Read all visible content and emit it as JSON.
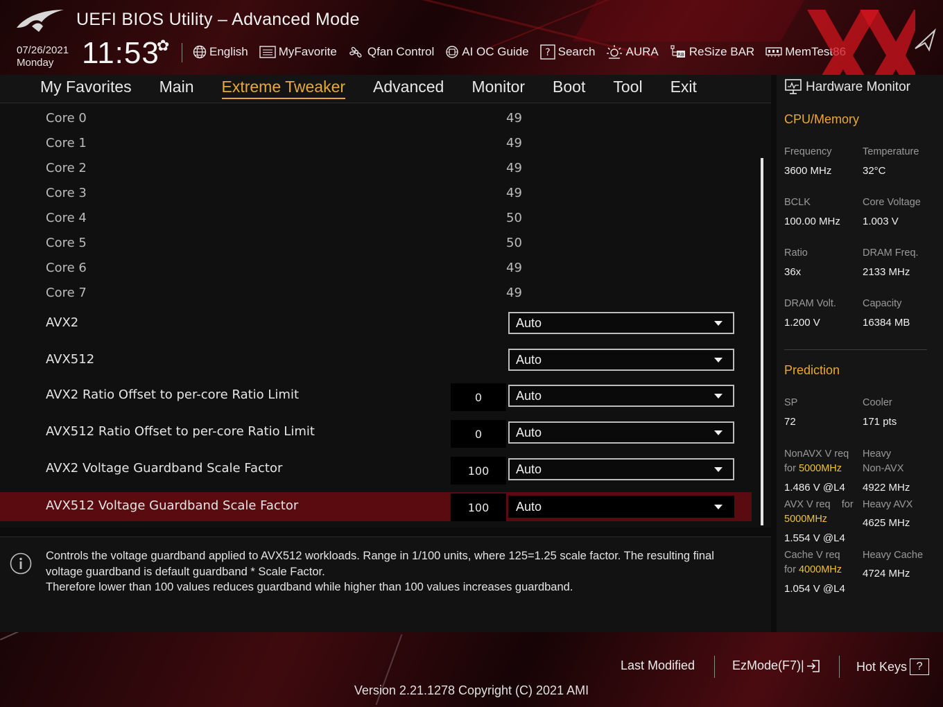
{
  "header": {
    "title": "UEFI BIOS Utility – Advanced Mode",
    "date": "07/26/2021",
    "day": "Monday",
    "time": "11:53",
    "tools": [
      {
        "label": "English",
        "icon": "globe-icon"
      },
      {
        "label": "MyFavorite",
        "icon": "favorite-icon"
      },
      {
        "label": "Qfan Control",
        "icon": "fan-icon"
      },
      {
        "label": "AI OC Guide",
        "icon": "ai-chip-icon"
      },
      {
        "label": "Search",
        "icon": "help-search-icon"
      },
      {
        "label": "AURA",
        "icon": "aura-light-icon"
      },
      {
        "label": "ReSize BAR",
        "icon": "resize-bar-icon"
      },
      {
        "label": "MemTest86",
        "icon": "memory-icon"
      }
    ]
  },
  "nav": {
    "tabs": [
      "My Favorites",
      "Main",
      "Extreme Tweaker",
      "Advanced",
      "Monitor",
      "Boot",
      "Tool",
      "Exit"
    ],
    "active": "Extreme Tweaker"
  },
  "settings": {
    "cores": [
      {
        "label": "Core 0",
        "value": "49"
      },
      {
        "label": "Core 1",
        "value": "49"
      },
      {
        "label": "Core 2",
        "value": "49"
      },
      {
        "label": "Core 3",
        "value": "49"
      },
      {
        "label": "Core 4",
        "value": "50"
      },
      {
        "label": "Core 5",
        "value": "50"
      },
      {
        "label": "Core 6",
        "value": "49"
      },
      {
        "label": "Core 7",
        "value": "49"
      }
    ],
    "options": [
      {
        "label": "AVX2",
        "box": "",
        "selected": "Auto"
      },
      {
        "label": "AVX512",
        "box": "",
        "selected": "Auto"
      },
      {
        "label": "AVX2 Ratio Offset to per-core Ratio Limit",
        "box": "0",
        "selected": "Auto"
      },
      {
        "label": "AVX512 Ratio Offset to per-core Ratio Limit",
        "box": "0",
        "selected": "Auto"
      },
      {
        "label": "AVX2 Voltage Guardband Scale Factor",
        "box": "100",
        "selected": "Auto"
      },
      {
        "label": "AVX512 Voltage Guardband Scale Factor",
        "box": "100",
        "selected": "Auto"
      }
    ]
  },
  "help": {
    "line1": "Controls the voltage guardband applied to AVX512 workloads. Range in 1/100 units, where 125=1.25 scale factor. The resulting final",
    "line2": "voltage guardband is default guardband * Scale Factor.",
    "line3": "Therefore lower than 100 values reduces guardband while higher than 100 values increases guardband."
  },
  "hw": {
    "title": "Hardware Monitor",
    "cpu_section": "CPU/Memory",
    "freq_label": "Frequency",
    "freq_value": "3600 MHz",
    "temp_label": "Temperature",
    "temp_value": "32°C",
    "bclk_label": "BCLK",
    "bclk_value": "100.00 MHz",
    "corev_label": "Core Voltage",
    "corev_value": "1.003 V",
    "ratio_label": "Ratio",
    "ratio_value": "36x",
    "dramf_label": "DRAM Freq.",
    "dramf_value": "2133 MHz",
    "dramv_label": "DRAM Volt.",
    "dramv_value": "1.200 V",
    "cap_label": "Capacity",
    "cap_value": "16384 MB",
    "pred_section": "Prediction",
    "sp_label": "SP",
    "sp_value": "72",
    "cooler_label": "Cooler",
    "cooler_value": "171 pts",
    "nonavx_label": "NonAVX V req",
    "nonavx_for": "for",
    "nonavx_freq": "5000MHz",
    "nonavx_value": "1.486 V @L4",
    "heavy_nonavx_label1": "Heavy",
    "heavy_nonavx_label2": "Non-AVX",
    "heavy_nonavx_value": "4922 MHz",
    "avx_label": "AVX V req",
    "avx_for": "for",
    "avx_freq": "5000MHz",
    "avx_value": "1.554 V @L4",
    "heavy_avx_label": "Heavy AVX",
    "heavy_avx_value": "4625 MHz",
    "cache_label": "Cache V req",
    "cache_for": "for",
    "cache_freq": "4000MHz",
    "cache_value": "1.054 V @L4",
    "heavy_cache_label": "Heavy Cache",
    "heavy_cache_value": "4724 MHz"
  },
  "footer": {
    "last_modified": "Last Modified",
    "ezmode": "EzMode(F7)|",
    "hotkeys": "Hot Keys",
    "hotkeys_badge": "?",
    "version": "Version 2.21.1278 Copyright (C) 2021 AMI"
  },
  "colors": {
    "accent": "#e9a93a",
    "selected_row": "#5a0b10",
    "highlight": "#f0c23a"
  }
}
